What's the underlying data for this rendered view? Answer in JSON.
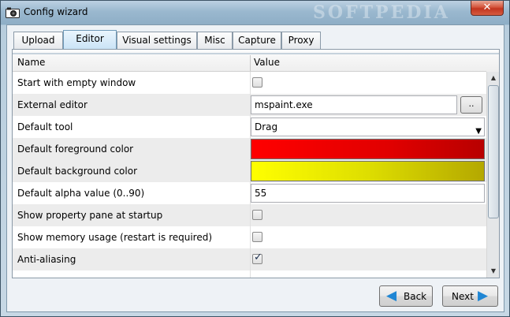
{
  "window": {
    "title": "Config wizard",
    "watermark": "SOFTPEDIA",
    "close_label": "✕"
  },
  "tabs": [
    {
      "label": "Upload",
      "active": false
    },
    {
      "label": "Editor",
      "active": true
    },
    {
      "label": "Visual settings",
      "active": false
    },
    {
      "label": "Misc",
      "active": false
    },
    {
      "label": "Capture",
      "active": false
    },
    {
      "label": "Proxy",
      "active": false
    }
  ],
  "table": {
    "columns": [
      "Name",
      "Value"
    ],
    "rows": [
      {
        "name": "Start with empty window",
        "type": "checkbox",
        "checked": false
      },
      {
        "name": "External editor",
        "type": "text-browse",
        "value": "mspaint.exe",
        "button": ".."
      },
      {
        "name": "Default tool",
        "type": "select",
        "value": "Drag"
      },
      {
        "name": "Default foreground color",
        "type": "color",
        "color": "#ff0000"
      },
      {
        "name": "Default background color",
        "type": "color",
        "color": "#ffff00"
      },
      {
        "name": "Default alpha value (0..90)",
        "type": "text",
        "value": "55"
      },
      {
        "name": "Show property pane at startup",
        "type": "checkbox",
        "checked": false
      },
      {
        "name": "Show memory usage (restart is required)",
        "type": "checkbox",
        "checked": false
      },
      {
        "name": "Anti-aliasing",
        "type": "checkbox",
        "checked": true
      }
    ]
  },
  "buttons": {
    "back": "Back",
    "next": "Next"
  },
  "colors": {
    "foreground": "#ff0000",
    "background": "#ffff00",
    "active_tab": "#c9e3f6"
  },
  "icons": {
    "app": "camera-icon",
    "back": "arrow-left-icon",
    "next": "arrow-right-icon"
  }
}
